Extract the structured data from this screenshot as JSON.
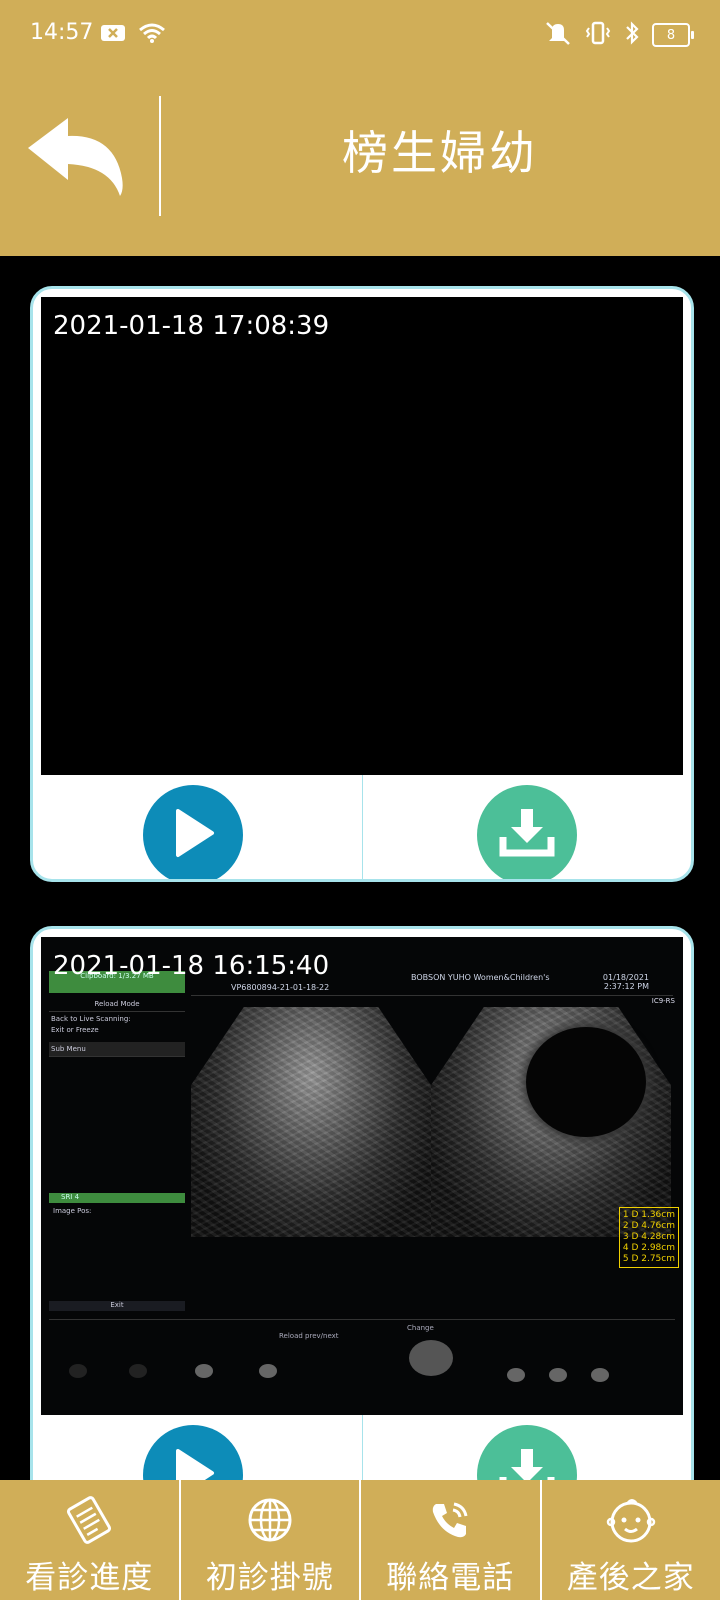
{
  "status": {
    "time": "14:57",
    "battery": "8"
  },
  "header": {
    "title": "榜生婦幼"
  },
  "videos": [
    {
      "timestamp": "2021-01-18 17:08:39"
    },
    {
      "timestamp": "2021-01-18 16:15:40"
    }
  ],
  "ultrasound": {
    "clinic": "BOBSON YUHO Women&Children's",
    "patient_id": "VP6800894-21-01-18-22",
    "date": "01/18/2021",
    "time": "2:37:12 PM",
    "probe": "IC9-RS",
    "clipboard": "Clipboard: 1/3.27 MB",
    "menu_title": "Reload Mode",
    "menu_line1": "Back to Live Scanning:",
    "menu_line2": "Exit or Freeze",
    "submenu": "Sub Menu",
    "sri": "SRI 4",
    "image_pos": "Image Pos:",
    "exit": "Exit",
    "change": "Change",
    "reload": "Reload prev/next",
    "measurements": [
      "1 D 1.36cm",
      "2 D 4.76cm",
      "3 D 4.28cm",
      "4 D 2.98cm",
      "5 D 2.75cm"
    ]
  },
  "bottom_nav": [
    {
      "label": "看診進度",
      "icon": "clipboard-list-icon"
    },
    {
      "label": "初診掛號",
      "icon": "globe-icon"
    },
    {
      "label": "聯絡電話",
      "icon": "phone-icon"
    },
    {
      "label": "產後之家",
      "icon": "baby-face-icon"
    }
  ],
  "colors": {
    "header": "#D0AE58",
    "play": "#0D8CB8",
    "download": "#4CBF98",
    "card_border": "#A7E3EB"
  }
}
